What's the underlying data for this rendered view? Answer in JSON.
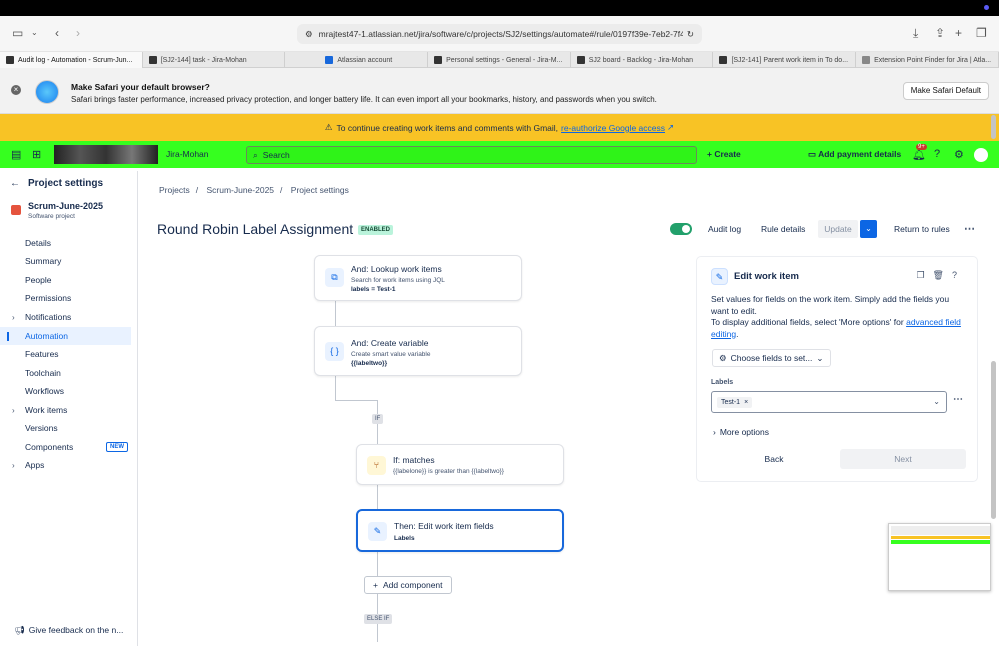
{
  "browser": {
    "url": "mrajtest47-1.atlassian.net/jira/software/c/projects/SJ2/settings/automate#/rule/0197f39e-7eb2-7f4f-9",
    "tabs": [
      {
        "label": "Audit log - Automation - Scrum-Jun..."
      },
      {
        "label": "[SJ2-144] task - Jira-Mohan"
      },
      {
        "label": "Atlassian account"
      },
      {
        "label": "Personal settings - General - Jira-M..."
      },
      {
        "label": "SJ2 board - Backlog - Jira-Mohan"
      },
      {
        "label": "[SJ2-141] Parent work item in To do..."
      },
      {
        "label": "Extension Point Finder for Jira | Atla..."
      }
    ]
  },
  "safari_banner": {
    "title": "Make Safari your default browser?",
    "text": "Safari brings faster performance, increased privacy protection, and longer battery life. It can even import all your bookmarks, history, and passwords when you switch.",
    "button": "Make Safari Default"
  },
  "gmail_banner": {
    "text": "To continue creating work items and comments with Gmail,",
    "link": "re-authorize Google access"
  },
  "jira_top": {
    "site_name": "Jira-Mohan",
    "search_placeholder": "Search",
    "create": "Create",
    "payment": "Add payment details",
    "badge": "9+"
  },
  "sidebar": {
    "back": "Project settings",
    "project_name": "Scrum-June-2025",
    "project_type": "Software project",
    "items": [
      {
        "label": "Details"
      },
      {
        "label": "Summary"
      },
      {
        "label": "People"
      },
      {
        "label": "Permissions"
      },
      {
        "label": "Notifications"
      },
      {
        "label": "Automation"
      },
      {
        "label": "Features"
      },
      {
        "label": "Toolchain"
      },
      {
        "label": "Workflows"
      },
      {
        "label": "Work items"
      },
      {
        "label": "Versions"
      },
      {
        "label": "Components",
        "badge": "NEW"
      },
      {
        "label": "Apps"
      }
    ],
    "feedback": "Give feedback on the n..."
  },
  "breadcrumb": [
    "Projects",
    "Scrum-June-2025",
    "Project settings"
  ],
  "rule": {
    "title": "Round Robin Label Assignment",
    "status": "ENABLED",
    "audit_log": "Audit log",
    "rule_details": "Rule details",
    "update": "Update",
    "return": "Return to rules"
  },
  "components": {
    "lookup": {
      "title": "And: Lookup work items",
      "sub": "Search for work items using JQL",
      "val": "labels = Test-1"
    },
    "variable": {
      "title": "And: Create variable",
      "sub": "Create smart value variable",
      "val": "{{labeltwo}}"
    },
    "if_tag": "IF",
    "condition": {
      "title": "If: matches",
      "sub": "{{labelone}} is greater than {{labeltwo}}"
    },
    "action": {
      "title": "Then: Edit work item fields",
      "val": "Labels"
    },
    "add_component": "Add component",
    "else_if_tag": "ELSE IF"
  },
  "panel": {
    "title": "Edit work item",
    "desc1": "Set values for fields on the work item. Simply add the fields you want to edit.",
    "desc2": "To display additional fields, select 'More options' for",
    "desc_link": "advanced field editing",
    "choose": "Choose fields to set...",
    "labels_label": "Labels",
    "chip": "Test-1",
    "more_options": "More options",
    "back": "Back",
    "next": "Next"
  }
}
